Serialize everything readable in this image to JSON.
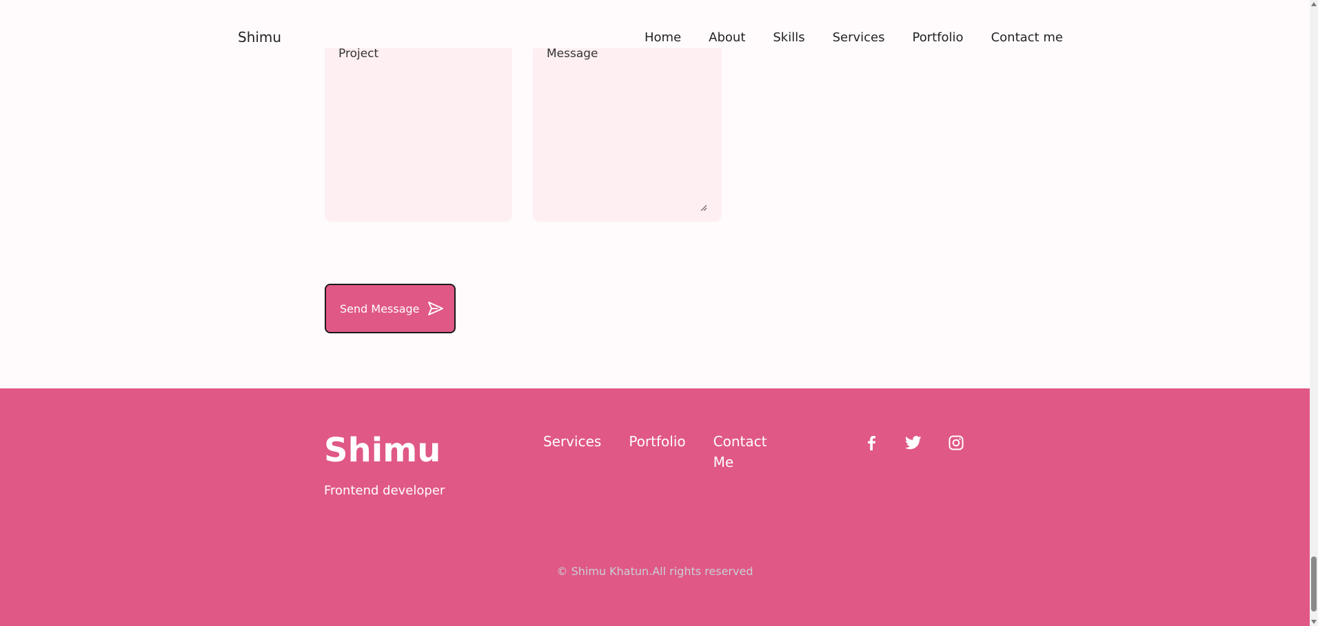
{
  "header": {
    "brand": "Shimu",
    "nav": [
      "Home",
      "About",
      "Skills",
      "Services",
      "Portfolio",
      "Contact me"
    ]
  },
  "form": {
    "project_placeholder": "Project",
    "message_placeholder": "Message",
    "send_label": "Send Message"
  },
  "footer": {
    "brand": "Shimu",
    "subtitle": "Frontend developer",
    "links": [
      "Services",
      "Portfolio",
      "Contact Me"
    ],
    "social_icons": [
      "facebook-icon",
      "twitter-icon",
      "instagram-icon"
    ],
    "copyright": "© Shimu Khatun.All rights reserved"
  },
  "colors": {
    "accent": "#e05885",
    "page_bg": "#fffbfc",
    "field_bg": "#fdeff2"
  }
}
